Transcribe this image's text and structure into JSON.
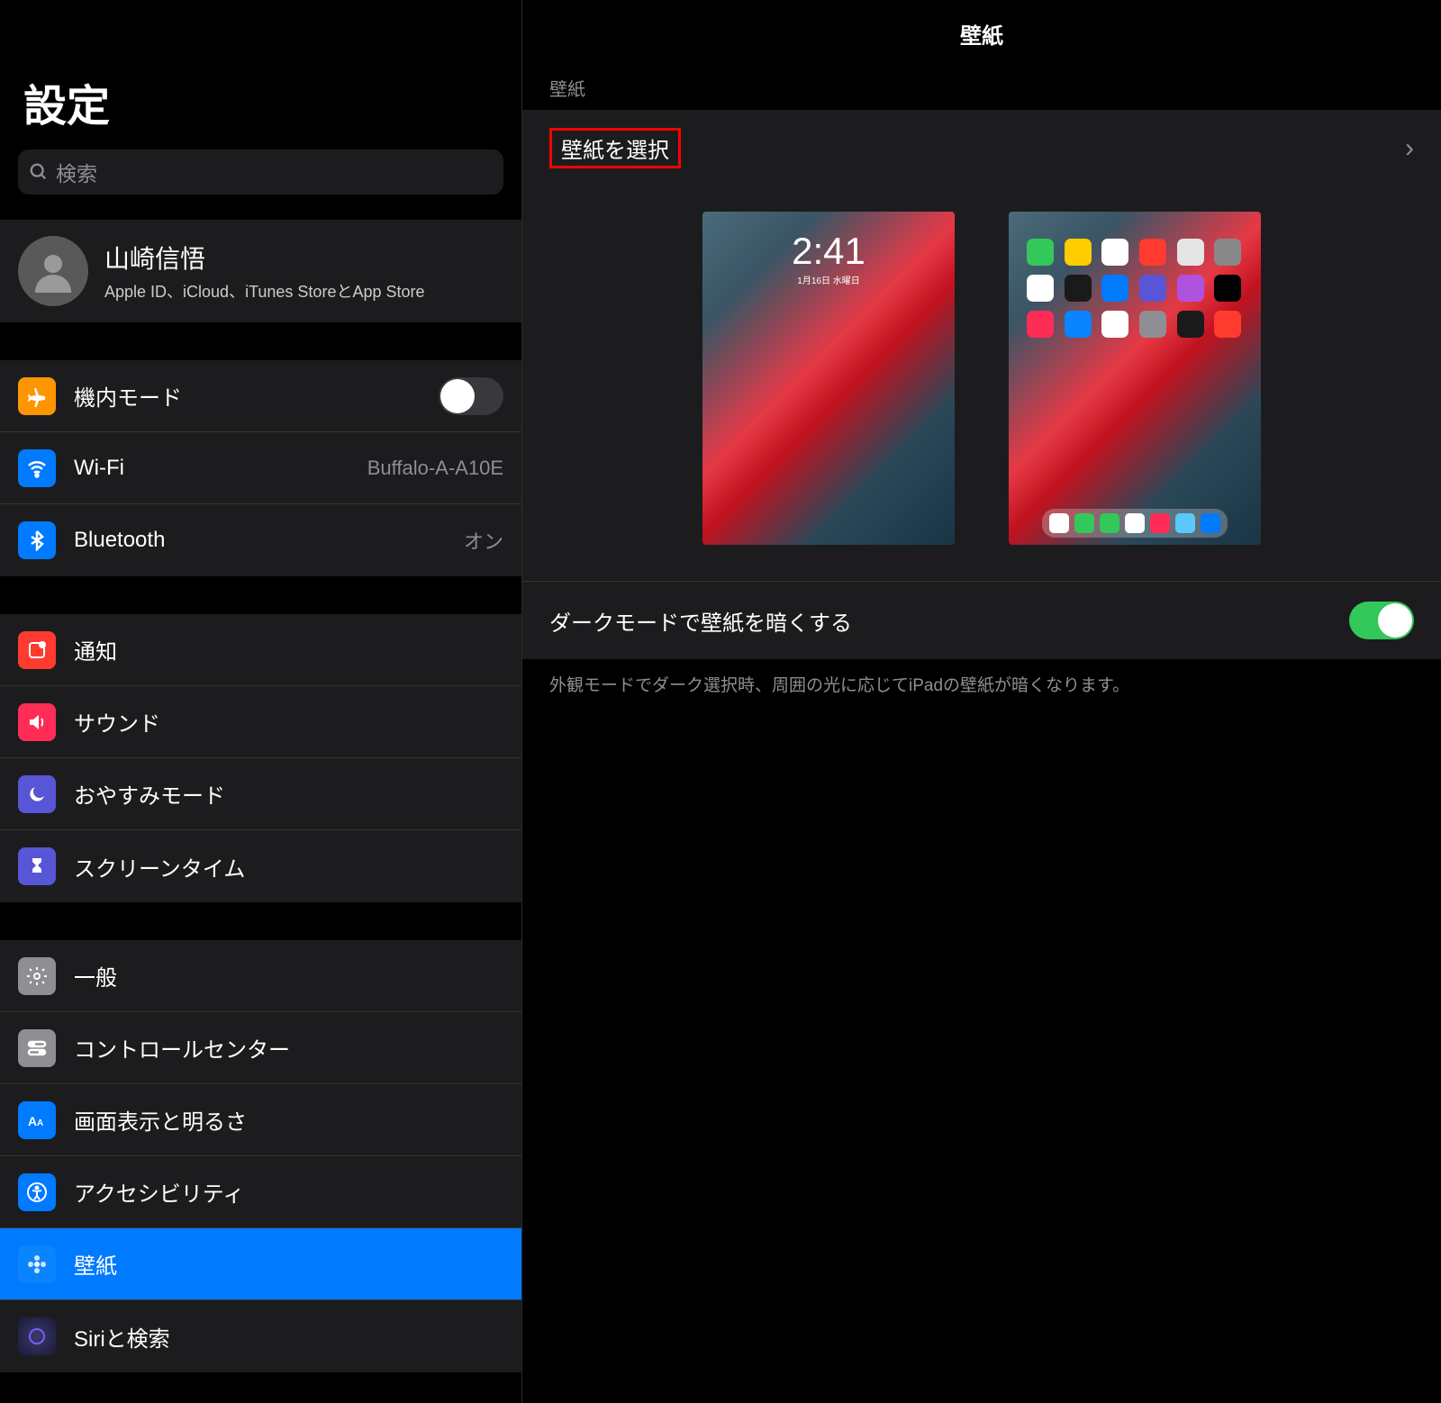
{
  "sidebar": {
    "title": "設定",
    "search_placeholder": "検索",
    "profile": {
      "name": "山崎信悟",
      "subtitle": "Apple ID、iCloud、iTunes StoreとApp Store"
    },
    "g1": {
      "airplane": "機内モード",
      "wifi": "Wi-Fi",
      "wifi_value": "Buffalo-A-A10E",
      "bluetooth": "Bluetooth",
      "bluetooth_value": "オン"
    },
    "g2": {
      "notifications": "通知",
      "sounds": "サウンド",
      "dnd": "おやすみモード",
      "screentime": "スクリーンタイム"
    },
    "g3": {
      "general": "一般",
      "control": "コントロールセンター",
      "display": "画面表示と明るさ",
      "accessibility": "アクセシビリティ",
      "wallpaper": "壁紙",
      "siri": "Siriと検索"
    }
  },
  "main": {
    "title": "壁紙",
    "section_label": "壁紙",
    "choose": "壁紙を選択",
    "lock_time": "2:41",
    "lock_date": "1月16日 水曜日",
    "dim_label": "ダークモードで壁紙を暗くする",
    "footer": "外観モードでダーク選択時、周囲の光に応じてiPadの壁紙が暗くなります。"
  }
}
